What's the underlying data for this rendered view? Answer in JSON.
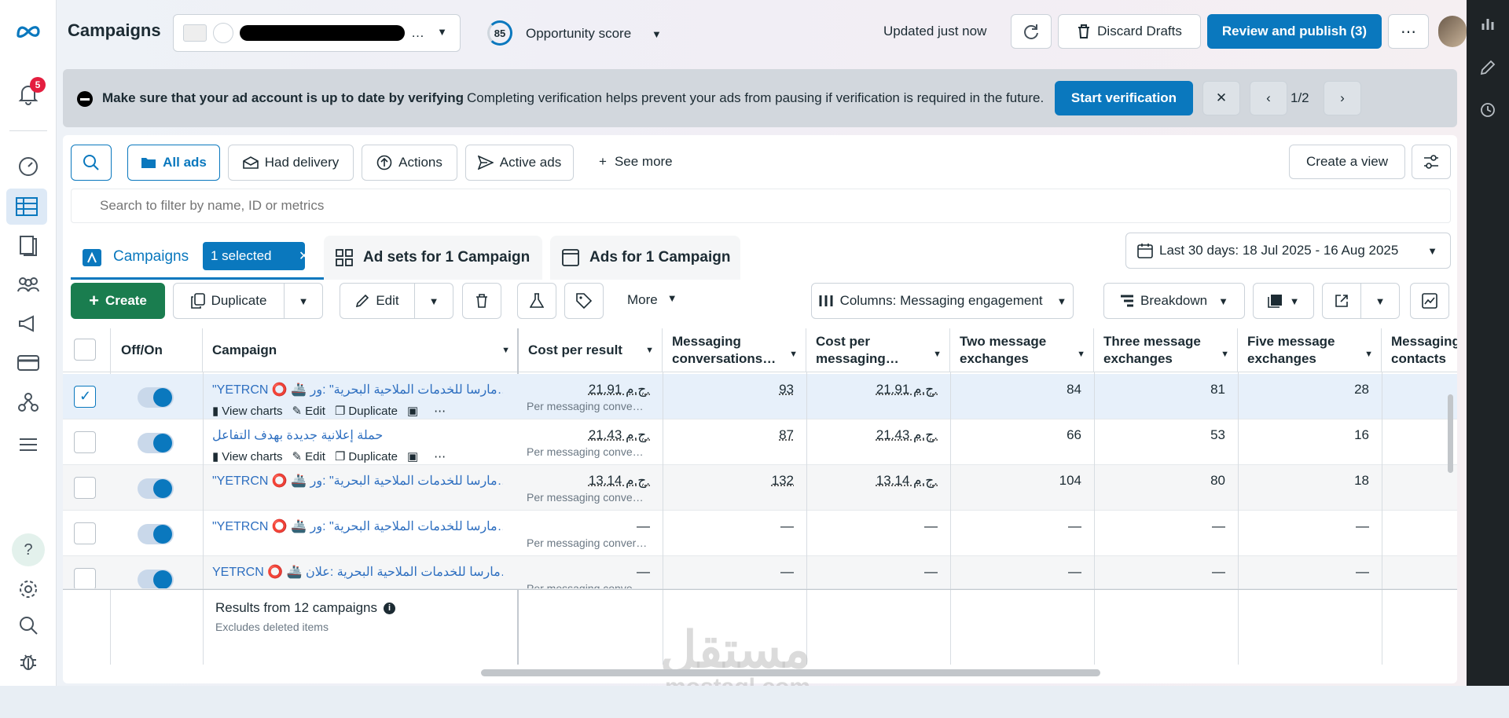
{
  "nav": {
    "notification_count": "5"
  },
  "header": {
    "title": "Campaigns",
    "account_name": "…",
    "opportunity_score": "85",
    "opportunity_label": "Opportunity score",
    "updated": "Updated just now",
    "discard_label": "Discard Drafts",
    "publish_label": "Review and publish (3)"
  },
  "banner": {
    "title": "Make sure that your ad account is up to date by verifying",
    "text": "Completing verification helps prevent your ads from pausing if verification is required in the future.",
    "button": "Start verification",
    "pager": "1/2"
  },
  "filters": {
    "all_ads": "All ads",
    "had_delivery": "Had delivery",
    "actions": "Actions",
    "active_ads": "Active ads",
    "see_more": "See more",
    "create_view": "Create a view",
    "search_placeholder": "Search to filter by name, ID or metrics"
  },
  "tabs": {
    "campaigns": "Campaigns",
    "selected": "1 selected",
    "adsets": "Ad sets for 1 Campaign",
    "ads": "Ads for 1 Campaign",
    "date_range": "Last 30 days: 18 Jul 2025 - 16 Aug 2025"
  },
  "toolbar": {
    "create": "Create",
    "duplicate": "Duplicate",
    "edit": "Edit",
    "more": "More",
    "columns": "Columns: Messaging engagement",
    "breakdown": "Breakdown"
  },
  "table": {
    "headers": {
      "offon": "Off/On",
      "campaign": "Campaign",
      "cpr": "Cost per result",
      "conv": "Messaging conversations…",
      "cpm": "Cost per messaging…",
      "two": "Two message exchanges",
      "three": "Three message exchanges",
      "five": "Five message exchanges",
      "contacts": "Messaging contacts"
    },
    "row_actions": {
      "view_charts": "View charts",
      "edit": "Edit",
      "duplicate": "Duplicate"
    },
    "rows": [
      {
        "name": "\"YETRCN ⭕ 🚢 مارسا للخدمات الملاحية البحرية\" :ور…",
        "cpr": "21.91 ج.م.",
        "cpr_sub": "Per messaging conve…",
        "conv": "93",
        "cpm": "21.91 ج.م.",
        "two": "84",
        "three": "81",
        "five": "28",
        "selected": true
      },
      {
        "name": "حملة إعلانية جديدة بهدف التفاعل",
        "cpr": "21.43 ج.م.",
        "cpr_sub": "Per messaging conve…",
        "conv": "87",
        "cpm": "21.43 ج.م.",
        "two": "66",
        "three": "53",
        "five": "16",
        "selected": false
      },
      {
        "name": "\"YETRCN ⭕ 🚢 مارسا للخدمات الملاحية البحرية\" :ور…",
        "cpr": "13.14 ج.م.",
        "cpr_sub": "Per messaging conve…",
        "conv": "132",
        "cpm": "13.14 ج.م.",
        "two": "104",
        "three": "80",
        "five": "18",
        "selected": false
      },
      {
        "name": "\"YETRCN ⭕ 🚢 مارسا للخدمات الملاحية البحرية\" :ور…",
        "cpr": "—",
        "cpr_sub": "Per messaging conver…",
        "conv": "—",
        "cpm": "—",
        "two": "—",
        "three": "—",
        "five": "—",
        "selected": false
      },
      {
        "name": "YETRCN ⭕ 🚢 مارسا للخدمات الملاحية البحرية :علان…",
        "cpr": "—",
        "cpr_sub": "Per messaging conve…",
        "conv": "—",
        "cpm": "—",
        "two": "—",
        "three": "—",
        "five": "—",
        "selected": false
      }
    ],
    "results": "Results from 12 campaigns",
    "excludes": "Excludes deleted items"
  },
  "watermark": {
    "arabic": "مستقل",
    "latin": "mostaql.com"
  },
  "colors": {
    "accent": "#0a78be",
    "create_green": "#1a7d4f",
    "notif_red": "#e41e3f"
  }
}
